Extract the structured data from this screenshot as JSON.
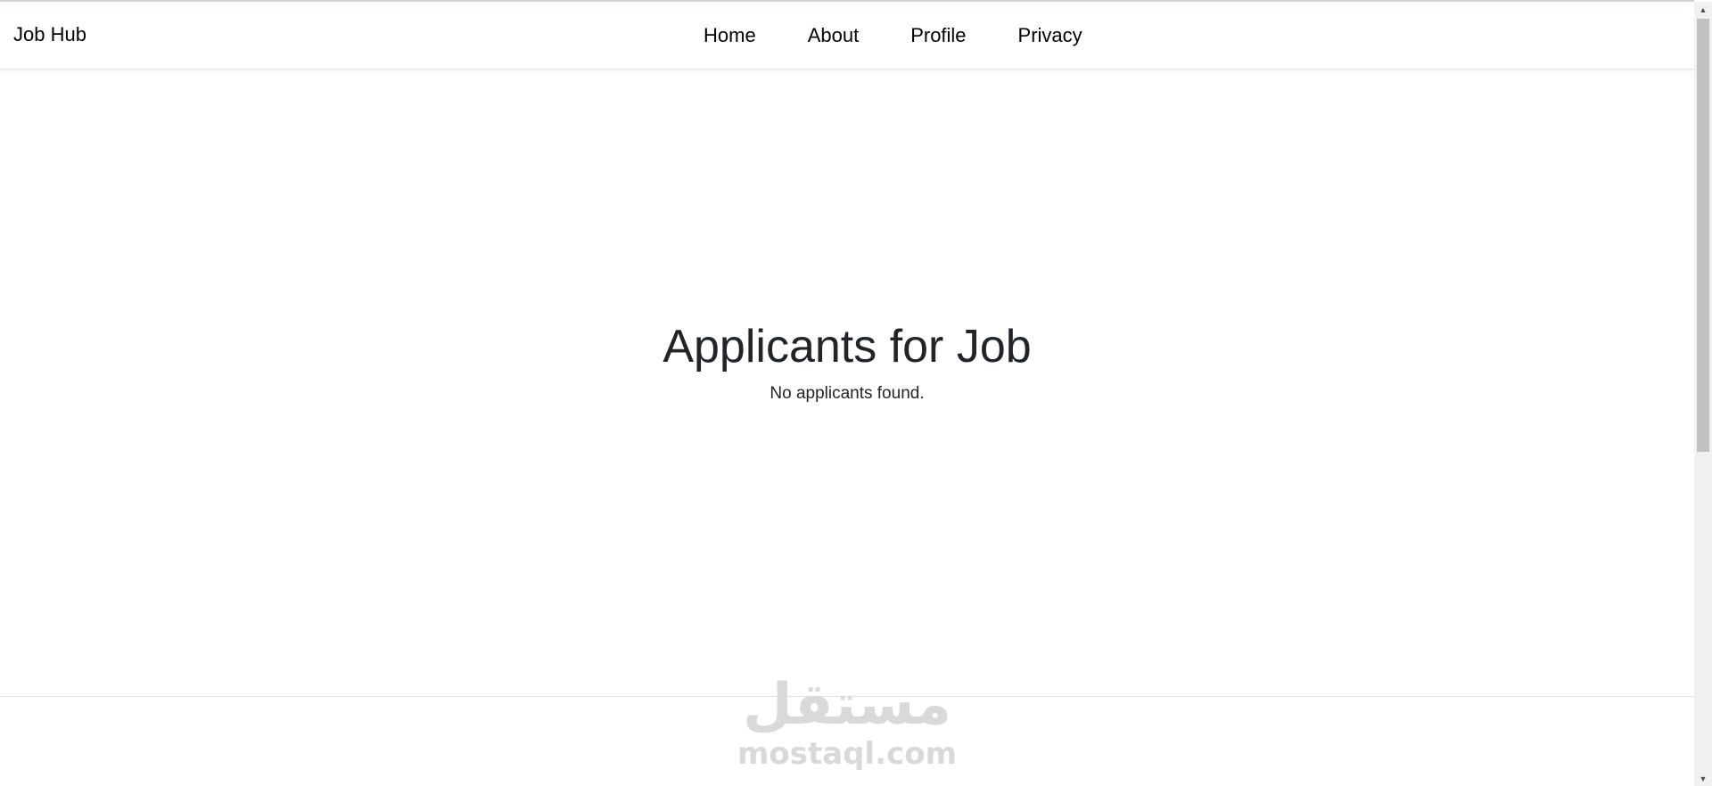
{
  "navbar": {
    "brand": "Job Hub",
    "links": [
      "Home",
      "About",
      "Profile",
      "Privacy"
    ]
  },
  "main": {
    "title": "Applicants for Job",
    "message": "No applicants found."
  },
  "watermark": {
    "logo_text": "مستقل",
    "site": "mostaql.com"
  },
  "scrollbar": {
    "up_icon": "triangle-up-icon",
    "down_icon": "triangle-down-icon"
  },
  "colors": {
    "text": "#212529",
    "nav_text": "#000000",
    "watermark": "#d9d9d9",
    "scroll_thumb": "#c1c1c1"
  }
}
